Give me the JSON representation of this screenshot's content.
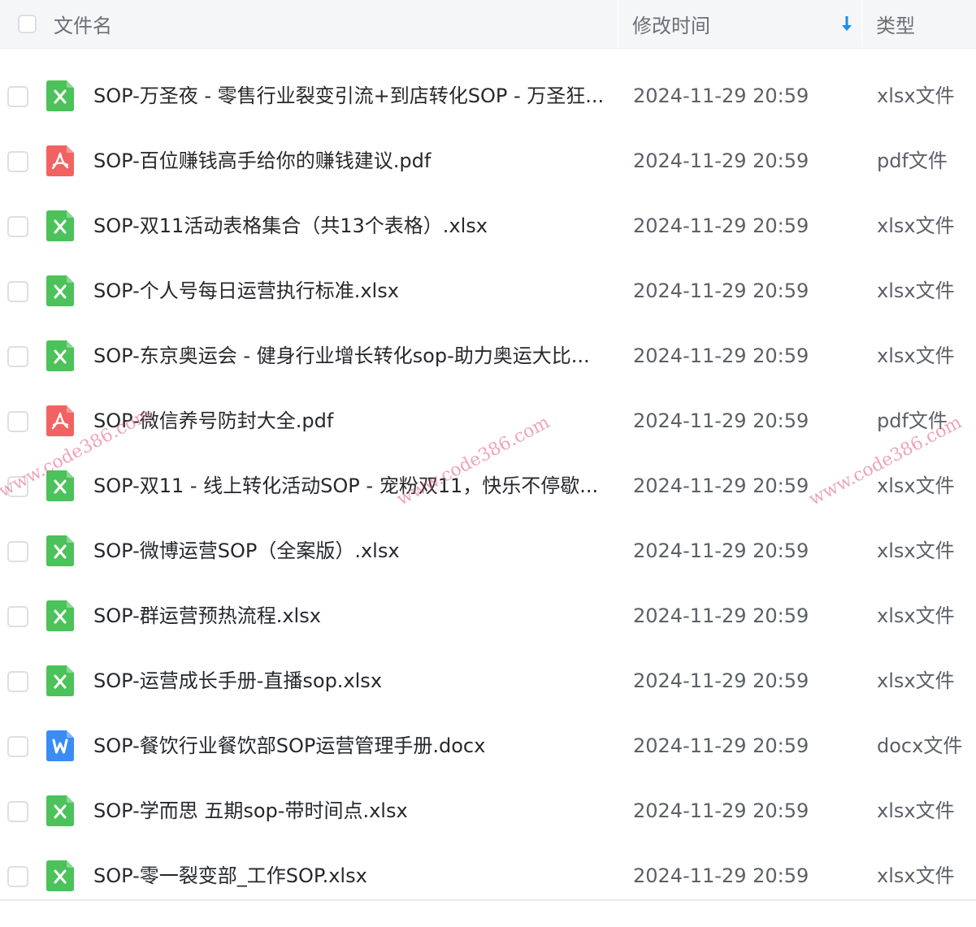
{
  "header": {
    "name_label": "文件名",
    "time_label": "修改时间",
    "type_label": "类型",
    "sort_icon": "arrow-down-icon",
    "sort_color": "#1a8cf0"
  },
  "icons": {
    "xlsx": {
      "name": "xlsx-file-icon",
      "color": "#4cc25a"
    },
    "pdf": {
      "name": "pdf-file-icon",
      "color": "#f26262"
    },
    "docx": {
      "name": "docx-file-icon",
      "color": "#3a8cf5"
    }
  },
  "files": [
    {
      "name": "SOP-万圣夜 - 零售行业裂变引流+到店转化SOP - 万圣狂...",
      "time": "2024-11-29 20:59",
      "type": "xlsx文件",
      "kind": "xlsx"
    },
    {
      "name": "SOP-百位赚钱高手给你的赚钱建议.pdf",
      "time": "2024-11-29 20:59",
      "type": "pdf文件",
      "kind": "pdf"
    },
    {
      "name": "SOP-双11活动表格集合（共13个表格）.xlsx",
      "time": "2024-11-29 20:59",
      "type": "xlsx文件",
      "kind": "xlsx"
    },
    {
      "name": "SOP-个人号每日运营执行标准.xlsx",
      "time": "2024-11-29 20:59",
      "type": "xlsx文件",
      "kind": "xlsx"
    },
    {
      "name": "SOP-东京奥运会 - 健身行业增长转化sop-助力奥运大比...",
      "time": "2024-11-29 20:59",
      "type": "xlsx文件",
      "kind": "xlsx"
    },
    {
      "name": "SOP-微信养号防封大全.pdf",
      "time": "2024-11-29 20:59",
      "type": "pdf文件",
      "kind": "pdf"
    },
    {
      "name": "SOP-双11 - 线上转化活动SOP - 宠粉双11，快乐不停歇...",
      "time": "2024-11-29 20:59",
      "type": "xlsx文件",
      "kind": "xlsx"
    },
    {
      "name": "SOP-微博运营SOP（全案版）.xlsx",
      "time": "2024-11-29 20:59",
      "type": "xlsx文件",
      "kind": "xlsx"
    },
    {
      "name": "SOP-群运营预热流程.xlsx",
      "time": "2024-11-29 20:59",
      "type": "xlsx文件",
      "kind": "xlsx"
    },
    {
      "name": "SOP-运营成长手册-直播sop.xlsx",
      "time": "2024-11-29 20:59",
      "type": "xlsx文件",
      "kind": "xlsx"
    },
    {
      "name": "SOP-餐饮行业餐饮部SOP运营管理手册.docx",
      "time": "2024-11-29 20:59",
      "type": "docx文件",
      "kind": "docx"
    },
    {
      "name": "SOP-学而思 五期sop-带时间点.xlsx",
      "time": "2024-11-29 20:59",
      "type": "xlsx文件",
      "kind": "xlsx"
    },
    {
      "name": "SOP-零一裂变部_工作SOP.xlsx",
      "time": "2024-11-29 20:59",
      "type": "xlsx文件",
      "kind": "xlsx"
    }
  ],
  "watermarks": [
    "www.code386.com",
    "www.code386.com",
    "www.code386.com"
  ]
}
